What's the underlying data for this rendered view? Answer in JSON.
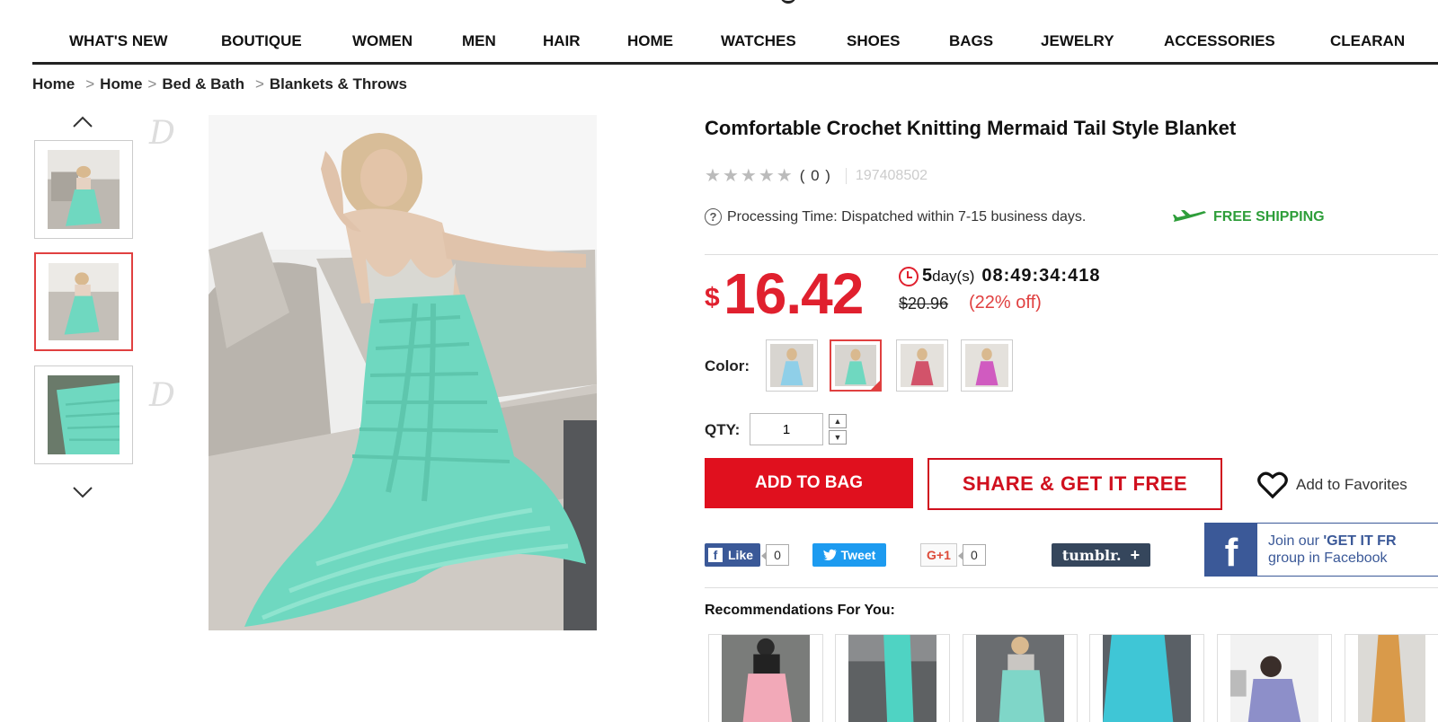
{
  "nav": {
    "items": [
      "WHAT'S NEW",
      "BOUTIQUE",
      "WOMEN",
      "MEN",
      "HAIR",
      "HOME",
      "WATCHES",
      "SHOES",
      "BAGS",
      "JEWELRY",
      "ACCESSORIES",
      "CLEARAN"
    ]
  },
  "breadcrumb": [
    "Home",
    "Home",
    "Bed & Bath",
    "Blankets & Throws"
  ],
  "product": {
    "title": "Comfortable Crochet Knitting Mermaid Tail Style Blanket",
    "rating_count": "( 0 )",
    "sku": "197408502",
    "processing_time": "Processing Time: Dispatched within 7-15 business days.",
    "free_shipping": "FREE SHIPPING",
    "currency": "$",
    "price": "16.42",
    "countdown_days": "5",
    "countdown_days_label": "day(s)",
    "countdown_time": "08:49:34:418",
    "old_price": "$20.96",
    "discount": "(22% off)",
    "color_label": "Color:",
    "qty_label": "QTY:",
    "qty_value": "1",
    "add_to_bag": "ADD TO BAG",
    "share_label": "SHARE & GET IT FREE",
    "add_to_favorites": "Add to Favorites"
  },
  "social": {
    "like_label": "Like",
    "like_count": "0",
    "tweet_label": "Tweet",
    "gplus_label": "G+1",
    "gplus_count": "0",
    "tumblr_label": "tumblr.",
    "join_line1_prefix": "Join our ",
    "join_line1_bold": "'GET IT FR",
    "join_line2": "group in Facebook"
  },
  "recommendations": {
    "title": "Recommendations For You:"
  },
  "colors": {
    "accent": "#e0101e",
    "free_shipping": "#2e9e3a",
    "facebook": "#3b5998",
    "twitter": "#1d9bf0",
    "tumblr": "#35465c",
    "blanket_mint": "#6fd8c0"
  },
  "icons": [
    "chevron-up-icon",
    "chevron-down-icon",
    "star-icon",
    "question-icon",
    "plane-icon",
    "clock-icon",
    "heart-icon",
    "facebook-icon",
    "twitter-icon",
    "plus-icon"
  ]
}
